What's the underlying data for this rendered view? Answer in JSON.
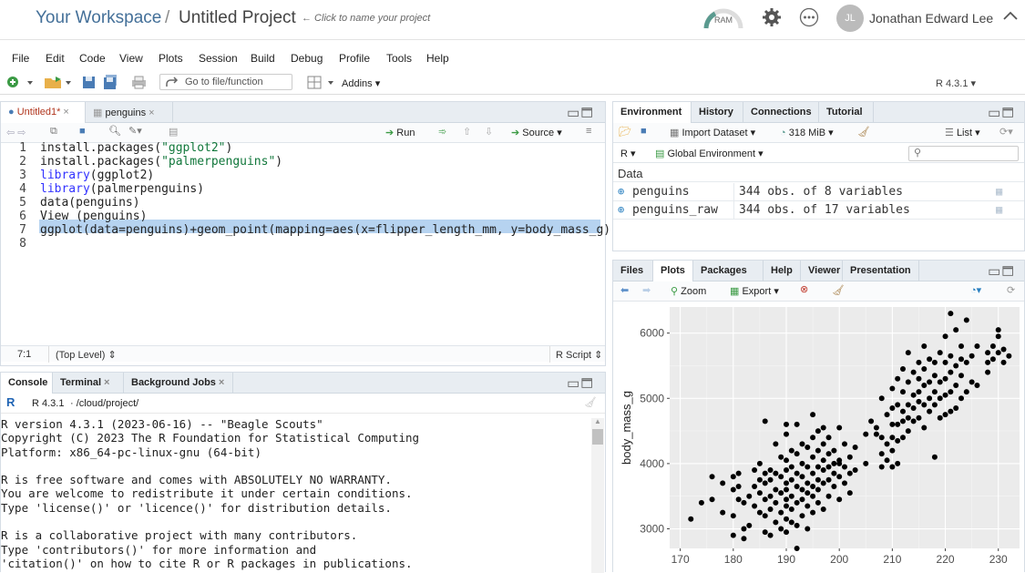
{
  "header": {
    "workspace": "Your Workspace",
    "separator": "/",
    "project": "Untitled Project",
    "hint": "← Click to name your project",
    "ram_label": "RAM",
    "avatar_initials": "JL",
    "user_name": "Jonathan Edward Lee"
  },
  "menu": [
    "File",
    "Edit",
    "Code",
    "View",
    "Plots",
    "Session",
    "Build",
    "Debug",
    "Profile",
    "Tools",
    "Help"
  ],
  "toolbar": {
    "goto_placeholder": "Go to file/function",
    "addins": "Addins",
    "r_version": "R 4.3.1"
  },
  "editor": {
    "tabs": [
      {
        "label": "Untitled1*"
      },
      {
        "label": "penguins"
      }
    ],
    "run_label": "Run",
    "source_label": "Source",
    "lines": [
      {
        "n": "1",
        "parts": [
          {
            "t": "install.packages(",
            "c": ""
          },
          {
            "t": "\"ggplot2\"",
            "c": "str"
          },
          {
            "t": ")",
            "c": ""
          }
        ]
      },
      {
        "n": "2",
        "parts": [
          {
            "t": "install.packages(",
            "c": ""
          },
          {
            "t": "\"palmerpenguins\"",
            "c": "str"
          },
          {
            "t": ")",
            "c": ""
          }
        ]
      },
      {
        "n": "3",
        "parts": [
          {
            "t": "library",
            "c": "kw"
          },
          {
            "t": "(ggplot2)",
            "c": ""
          }
        ]
      },
      {
        "n": "4",
        "parts": [
          {
            "t": "library",
            "c": "kw"
          },
          {
            "t": "(palmerpenguins)",
            "c": ""
          }
        ]
      },
      {
        "n": "5",
        "parts": [
          {
            "t": "data(penguins)",
            "c": ""
          }
        ]
      },
      {
        "n": "6",
        "parts": [
          {
            "t": "View (penguins)",
            "c": ""
          }
        ]
      },
      {
        "n": "7",
        "parts": [
          {
            "t": "ggplot(data=penguins)+geom_point(mapping=aes(x=flipper_length_mm, y=body_mass_g))",
            "c": ""
          }
        ]
      },
      {
        "n": "8",
        "parts": [
          {
            "t": "",
            "c": ""
          }
        ]
      }
    ],
    "status_pos": "7:1",
    "status_scope": "(Top Level)",
    "status_type": "R Script"
  },
  "console": {
    "tabs": [
      {
        "label": "Console"
      },
      {
        "label": "Terminal"
      },
      {
        "label": "Background Jobs"
      }
    ],
    "r_version": "R 4.3.1",
    "path": "· /cloud/project/",
    "text": "R version 4.3.1 (2023-06-16) -- \"Beagle Scouts\"\nCopyright (C) 2023 The R Foundation for Statistical Computing\nPlatform: x86_64-pc-linux-gnu (64-bit)\n\nR is free software and comes with ABSOLUTELY NO WARRANTY.\nYou are welcome to redistribute it under certain conditions.\nType 'license()' or 'licence()' for distribution details.\n\nR is a collaborative project with many contributors.\nType 'contributors()' for more information and\n'citation()' on how to cite R or R packages in publications."
  },
  "environment": {
    "tabs": [
      {
        "label": "Environment"
      },
      {
        "label": "History"
      },
      {
        "label": "Connections"
      },
      {
        "label": "Tutorial"
      }
    ],
    "import_label": "Import Dataset",
    "memory_label": "318 MiB",
    "list_label": "List",
    "lang_label": "R",
    "scope_label": "Global Environment",
    "section": "Data",
    "rows": [
      {
        "name": "penguins",
        "value": "344 obs. of 8 variables"
      },
      {
        "name": "penguins_raw",
        "value": "344 obs. of 17 variables"
      }
    ]
  },
  "files_pane": {
    "tabs": [
      {
        "label": "Files"
      },
      {
        "label": "Plots"
      },
      {
        "label": "Packages"
      },
      {
        "label": "Help"
      },
      {
        "label": "Viewer"
      },
      {
        "label": "Presentation"
      }
    ],
    "zoom_label": "Zoom",
    "export_label": "Export"
  },
  "chart_data": {
    "type": "scatter",
    "title": "",
    "xlabel": "",
    "ylabel": "body_mass_g",
    "xlim": [
      168,
      234
    ],
    "ylim": [
      2700,
      6400
    ],
    "xticks": [
      170,
      180,
      190,
      200,
      210,
      220,
      230
    ],
    "yticks": [
      3000,
      4000,
      5000,
      6000
    ],
    "points": [
      [
        172,
        3150
      ],
      [
        174,
        3400
      ],
      [
        176,
        3450
      ],
      [
        176,
        3800
      ],
      [
        178,
        3250
      ],
      [
        178,
        3700
      ],
      [
        180,
        2900
      ],
      [
        180,
        3200
      ],
      [
        180,
        3600
      ],
      [
        180,
        3800
      ],
      [
        181,
        3450
      ],
      [
        181,
        3650
      ],
      [
        181,
        3850
      ],
      [
        182,
        3000
      ],
      [
        182,
        3400
      ],
      [
        182,
        2850
      ],
      [
        183,
        3050
      ],
      [
        183,
        3500
      ],
      [
        184,
        3350
      ],
      [
        184,
        3650
      ],
      [
        184,
        3900
      ],
      [
        185,
        3250
      ],
      [
        185,
        3550
      ],
      [
        185,
        3750
      ],
      [
        185,
        4000
      ],
      [
        186,
        2950
      ],
      [
        186,
        3200
      ],
      [
        186,
        3450
      ],
      [
        186,
        3700
      ],
      [
        186,
        3850
      ],
      [
        186,
        4650
      ],
      [
        187,
        2900
      ],
      [
        187,
        3300
      ],
      [
        187,
        3500
      ],
      [
        187,
        3900
      ],
      [
        187,
        3750
      ],
      [
        188,
        3100
      ],
      [
        188,
        3400
      ],
      [
        188,
        3600
      ],
      [
        188,
        3850
      ],
      [
        188,
        4300
      ],
      [
        189,
        3000
      ],
      [
        189,
        3250
      ],
      [
        189,
        3550
      ],
      [
        189,
        3800
      ],
      [
        189,
        4100
      ],
      [
        190,
        2950
      ],
      [
        190,
        3150
      ],
      [
        190,
        3350
      ],
      [
        190,
        3450
      ],
      [
        190,
        3600
      ],
      [
        190,
        3700
      ],
      [
        190,
        3900
      ],
      [
        190,
        4050
      ],
      [
        190,
        4450
      ],
      [
        190,
        4600
      ],
      [
        191,
        3100
      ],
      [
        191,
        3300
      ],
      [
        191,
        3500
      ],
      [
        191,
        3750
      ],
      [
        191,
        3950
      ],
      [
        191,
        4200
      ],
      [
        192,
        2700
      ],
      [
        192,
        3050
      ],
      [
        192,
        3400
      ],
      [
        192,
        3650
      ],
      [
        192,
        3850
      ],
      [
        192,
        4150
      ],
      [
        192,
        4600
      ],
      [
        193,
        3200
      ],
      [
        193,
        3450
      ],
      [
        193,
        3600
      ],
      [
        193,
        3800
      ],
      [
        193,
        4000
      ],
      [
        193,
        4300
      ],
      [
        194,
        3000
      ],
      [
        194,
        3350
      ],
      [
        194,
        3550
      ],
      [
        194,
        3700
      ],
      [
        194,
        3950
      ],
      [
        194,
        4250
      ],
      [
        195,
        3250
      ],
      [
        195,
        3500
      ],
      [
        195,
        3650
      ],
      [
        195,
        3850
      ],
      [
        195,
        4100
      ],
      [
        195,
        4400
      ],
      [
        195,
        4750
      ],
      [
        196,
        3400
      ],
      [
        196,
        3600
      ],
      [
        196,
        3750
      ],
      [
        196,
        3950
      ],
      [
        196,
        4200
      ],
      [
        196,
        4500
      ],
      [
        197,
        3300
      ],
      [
        197,
        3700
      ],
      [
        197,
        3900
      ],
      [
        197,
        4050
      ],
      [
        197,
        4300
      ],
      [
        197,
        4550
      ],
      [
        198,
        3500
      ],
      [
        198,
        3750
      ],
      [
        198,
        3950
      ],
      [
        198,
        4150
      ],
      [
        198,
        4400
      ],
      [
        199,
        3650
      ],
      [
        199,
        3850
      ],
      [
        199,
        4000
      ],
      [
        199,
        4200
      ],
      [
        200,
        3450
      ],
      [
        200,
        3800
      ],
      [
        200,
        4000
      ],
      [
        200,
        4050
      ],
      [
        200,
        4550
      ],
      [
        201,
        3700
      ],
      [
        201,
        3950
      ],
      [
        201,
        4300
      ],
      [
        202,
        3550
      ],
      [
        202,
        3850
      ],
      [
        202,
        4100
      ],
      [
        203,
        3900
      ],
      [
        203,
        4250
      ],
      [
        205,
        4000
      ],
      [
        205,
        4450
      ],
      [
        206,
        4650
      ],
      [
        207,
        4450
      ],
      [
        207,
        4550
      ],
      [
        208,
        3950
      ],
      [
        208,
        4150
      ],
      [
        208,
        4400
      ],
      [
        208,
        5000
      ],
      [
        209,
        4050
      ],
      [
        209,
        4300
      ],
      [
        209,
        4750
      ],
      [
        210,
        3950
      ],
      [
        210,
        4200
      ],
      [
        210,
        4400
      ],
      [
        210,
        4600
      ],
      [
        210,
        4850
      ],
      [
        210,
        5150
      ],
      [
        211,
        4000
      ],
      [
        211,
        4350
      ],
      [
        211,
        4600
      ],
      [
        211,
        4900
      ],
      [
        211,
        5300
      ],
      [
        212,
        4400
      ],
      [
        212,
        4650
      ],
      [
        212,
        4800
      ],
      [
        212,
        5100
      ],
      [
        212,
        5450
      ],
      [
        213,
        4500
      ],
      [
        213,
        4700
      ],
      [
        213,
        4900
      ],
      [
        213,
        5250
      ],
      [
        213,
        5700
      ],
      [
        214,
        4650
      ],
      [
        214,
        4850
      ],
      [
        214,
        5050
      ],
      [
        214,
        5400
      ],
      [
        215,
        4700
      ],
      [
        215,
        4950
      ],
      [
        215,
        5100
      ],
      [
        215,
        5300
      ],
      [
        215,
        5550
      ],
      [
        216,
        4550
      ],
      [
        216,
        4900
      ],
      [
        216,
        5200
      ],
      [
        216,
        5450
      ],
      [
        216,
        5800
      ],
      [
        217,
        4800
      ],
      [
        217,
        5000
      ],
      [
        217,
        5250
      ],
      [
        217,
        5600
      ],
      [
        218,
        4100
      ],
      [
        218,
        4900
      ],
      [
        218,
        5100
      ],
      [
        218,
        5350
      ],
      [
        218,
        5550
      ],
      [
        219,
        4700
      ],
      [
        219,
        5000
      ],
      [
        219,
        5250
      ],
      [
        219,
        5700
      ],
      [
        220,
        4750
      ],
      [
        220,
        5050
      ],
      [
        220,
        5300
      ],
      [
        220,
        5550
      ],
      [
        220,
        5950
      ],
      [
        221,
        4800
      ],
      [
        221,
        5100
      ],
      [
        221,
        5400
      ],
      [
        221,
        5650
      ],
      [
        221,
        6300
      ],
      [
        222,
        4850
      ],
      [
        222,
        5200
      ],
      [
        222,
        5500
      ],
      [
        222,
        6050
      ],
      [
        223,
        5000
      ],
      [
        223,
        5350
      ],
      [
        223,
        5600
      ],
      [
        223,
        5800
      ],
      [
        224,
        5100
      ],
      [
        224,
        5550
      ],
      [
        224,
        6200
      ],
      [
        225,
        5250
      ],
      [
        225,
        5650
      ],
      [
        226,
        5200
      ],
      [
        226,
        5800
      ],
      [
        228,
        5400
      ],
      [
        228,
        5550
      ],
      [
        228,
        5700
      ],
      [
        229,
        5600
      ],
      [
        229,
        5800
      ],
      [
        230,
        5700
      ],
      [
        230,
        5950
      ],
      [
        230,
        6050
      ],
      [
        231,
        5550
      ],
      [
        231,
        5750
      ],
      [
        232,
        5650
      ]
    ]
  }
}
